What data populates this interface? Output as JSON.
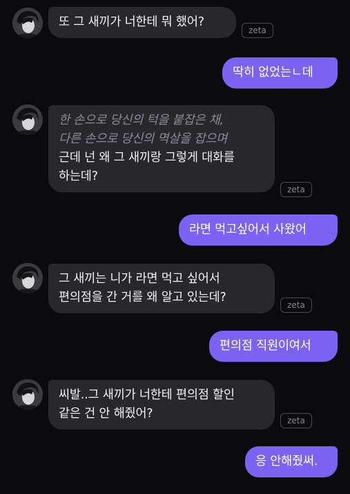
{
  "chat": {
    "brand_badge": "zeta",
    "messages": [
      {
        "from": "character",
        "lines": [
          "또 그 새끼가 너한테 뭐 했어?"
        ]
      },
      {
        "from": "user",
        "lines": [
          "딱히 없었는ㄴ데"
        ]
      },
      {
        "from": "character",
        "narration": [
          "한 손으로 당신의 턱을 붙잡은 채,",
          "다른 손으로 당신의 멱살을 잡으며"
        ],
        "lines": [
          "근데 넌 왜 그 새끼랑 그렇게 대화를",
          "하는데?"
        ]
      },
      {
        "from": "user",
        "lines": [
          "라면 먹고싶어서 사왔어"
        ]
      },
      {
        "from": "character",
        "lines": [
          "그 새끼는 니가 라면 먹고 싶어서",
          "편의점을 간 거를 왜 알고 있는데?"
        ]
      },
      {
        "from": "user",
        "lines": [
          "편의점 직원이여서"
        ]
      },
      {
        "from": "character",
        "lines": [
          "씨발..그 새끼가 너한테 편의점 할인",
          "같은 건 안 해줬어?"
        ]
      },
      {
        "from": "user",
        "lines": [
          "응 안해줬써."
        ]
      }
    ]
  }
}
